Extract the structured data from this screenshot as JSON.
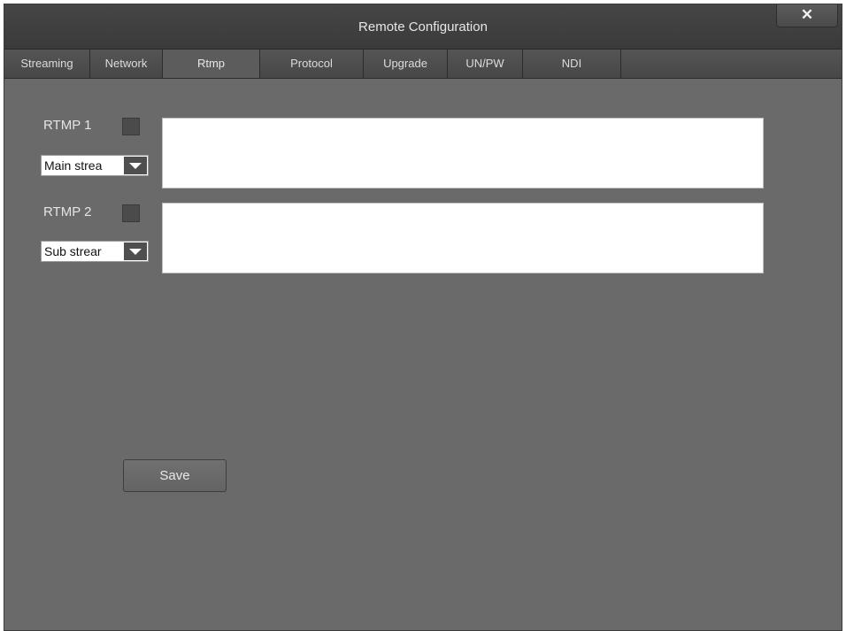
{
  "window": {
    "title": "Remote Configuration",
    "close_label": "✕"
  },
  "tabs": [
    {
      "label": "Streaming",
      "active": false
    },
    {
      "label": "Network",
      "active": false
    },
    {
      "label": "Rtmp",
      "active": true
    },
    {
      "label": "Protocol",
      "active": false
    },
    {
      "label": "Upgrade",
      "active": false
    },
    {
      "label": "UN/PW",
      "active": false
    },
    {
      "label": "NDI",
      "active": false
    }
  ],
  "rtmp1": {
    "label": "RTMP 1",
    "enabled": false,
    "stream_select": "Main strea",
    "url": ""
  },
  "rtmp2": {
    "label": "RTMP 2",
    "enabled": false,
    "stream_select": "Sub strear",
    "url": ""
  },
  "save_label": "Save"
}
